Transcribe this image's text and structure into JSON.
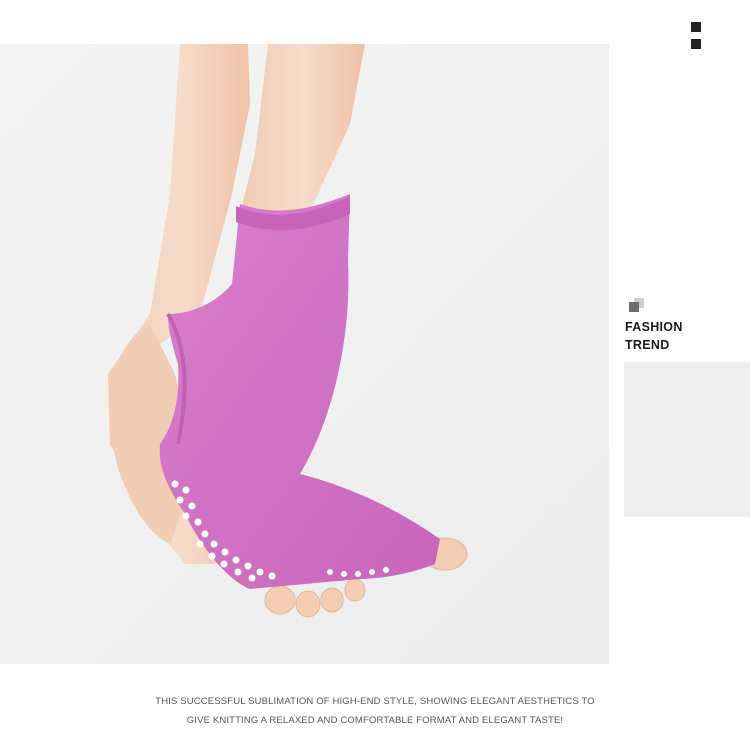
{
  "product_photo": {
    "subject": "pink-open-toe-yoga-sock-icon",
    "sock_color": "#d676c9",
    "grip_dot_color": "#ffffff"
  },
  "side_panel": {
    "title_line1": "FASHION",
    "title_line2": "TREND",
    "accent_dark": "#6e6e6e",
    "accent_light": "#cfcfcf",
    "panel_color": "#efefef"
  },
  "caption": {
    "line1": "THIS SUCCESSFUL SUBLIMATION OF HIGH-END STYLE, SHOWING ELEGANT AESTHETICS TO",
    "line2": "GIVE KNITTING A RELAXED AND COMFORTABLE FORMAT AND ELEGANT TASTE!"
  }
}
